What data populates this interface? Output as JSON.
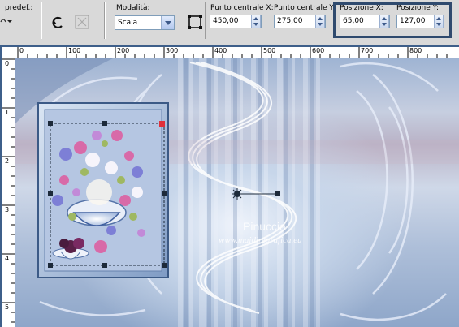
{
  "toolbar": {
    "preset_label": "predef.:",
    "mode_label": "Modalità:",
    "mode_value": "Scala",
    "center_x_label": "Punto centrale X:",
    "center_x_value": "450,00",
    "center_y_label": "Punto centrale Y:",
    "center_y_value": "275,00",
    "pos_x_label": "Posizione X:",
    "pos_x_value": "65,00",
    "pos_y_label": "Posizione Y:",
    "pos_y_value": "127,00"
  },
  "ruler": {
    "top_ticks": [
      "0",
      "100",
      "200",
      "300",
      "400",
      "500",
      "600",
      "700",
      "800"
    ],
    "left_ticks": [
      "0",
      "1",
      "2",
      "3",
      "4",
      "5"
    ]
  },
  "watermark": {
    "name": "Pinuccia",
    "url": "www.maidiregrafica.eu"
  },
  "colors": {
    "toolbar_bg": "#d9d9d9",
    "highlight_border": "#2f4a6e",
    "field_border": "#7f9db9",
    "handle_color": "#1d2a3a",
    "corner_handle": "#e0303a"
  },
  "icons": [
    "preset-dropdown-icon",
    "reset-icon",
    "apply-icon",
    "spin-up-icon",
    "spin-down-icon",
    "center-pick-icon",
    "rotation-handle-icon"
  ]
}
